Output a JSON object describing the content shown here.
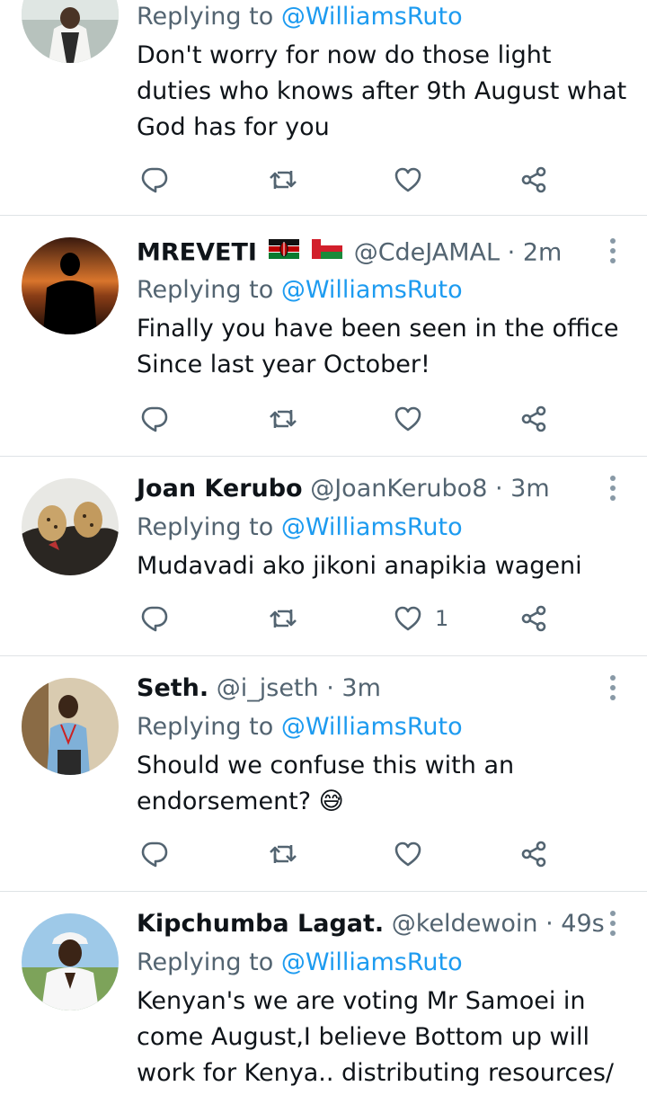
{
  "tweets": [
    {
      "display_name": "",
      "handle": "",
      "time": "",
      "replying_prefix": "Replying to ",
      "replying_to": "@WilliamsRuto",
      "text": "Don't worry for now do those light duties who knows after 9th August what God has for you",
      "likes": ""
    },
    {
      "display_name": "MREVETI",
      "handle": "@CdeJAMAL",
      "time": "· 2m",
      "replying_prefix": "Replying to ",
      "replying_to": "@WilliamsRuto",
      "text": "Finally you have been seen in the office Since last year October!",
      "likes": "",
      "flags": [
        "kenya-flag",
        "oman-flag"
      ]
    },
    {
      "display_name": "Joan Kerubo",
      "handle": "@JoanKerubo8",
      "time": "· 3m",
      "replying_prefix": "Replying to ",
      "replying_to": "@WilliamsRuto",
      "text": "Mudavadi ako jikoni anapikia wageni",
      "likes": "1"
    },
    {
      "display_name": "Seth.",
      "handle": "@i_jseth",
      "time": "· 3m",
      "replying_prefix": "Replying to ",
      "replying_to": "@WilliamsRuto",
      "text": "Should we confuse this with an endorsement? 😅",
      "likes": ""
    },
    {
      "display_name": "Kipchumba Lagat.",
      "handle": "@keldewoin",
      "time": "· 49s",
      "replying_prefix": "Replying to ",
      "replying_to": "@WilliamsRuto",
      "text": "Kenyan's we are voting Mr Samoei in come August,I believe Bottom up will work for Kenya.. distributing resources/",
      "likes": ""
    }
  ],
  "icons": {
    "reply": "reply-icon",
    "retweet": "retweet-icon",
    "like": "heart-icon",
    "share": "share-icon",
    "more": "more-options-icon"
  },
  "colors": {
    "link": "#1d9bf0",
    "secondary_text": "#536471",
    "primary_text": "#0f1419",
    "divider": "#dfe3e6"
  }
}
